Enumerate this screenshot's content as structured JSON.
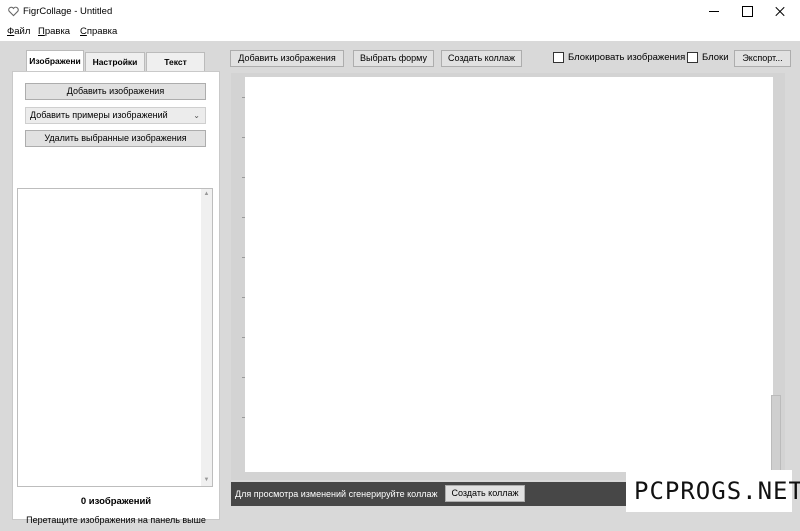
{
  "window": {
    "title": "FigrCollage - Untitled",
    "icon": "heart-icon"
  },
  "menu": {
    "file": {
      "u": "Ф",
      "rest": "айл"
    },
    "edit": {
      "u": "П",
      "rest": "равка"
    },
    "help": {
      "u": "С",
      "rest": "правка"
    }
  },
  "left_panel": {
    "tabs": [
      "Изображени",
      "Настройки",
      "Текст"
    ],
    "add_images_button": "Добавить изображения",
    "sample_images_combo": "Добавить примеры изображений",
    "remove_selected_button": "Удалить выбранные изображения",
    "image_count": "0 изображений",
    "drag_hint": "Перетащите изображения на панель выше"
  },
  "toolbar": {
    "add_images_button": "Добавить изображения",
    "choose_shape_button": "Выбрать форму",
    "create_collage_button": "Создать коллаж",
    "lock_images_label": "Блокировать изображения",
    "lock2_label": "Блоки",
    "export_button": "Экспорт..."
  },
  "bottom_bar": {
    "hint": "Для просмотра изменений сгенерируйте коллаж",
    "create_collage_button": "Создать коллаж"
  },
  "watermark": "PCPROGS.NET"
}
